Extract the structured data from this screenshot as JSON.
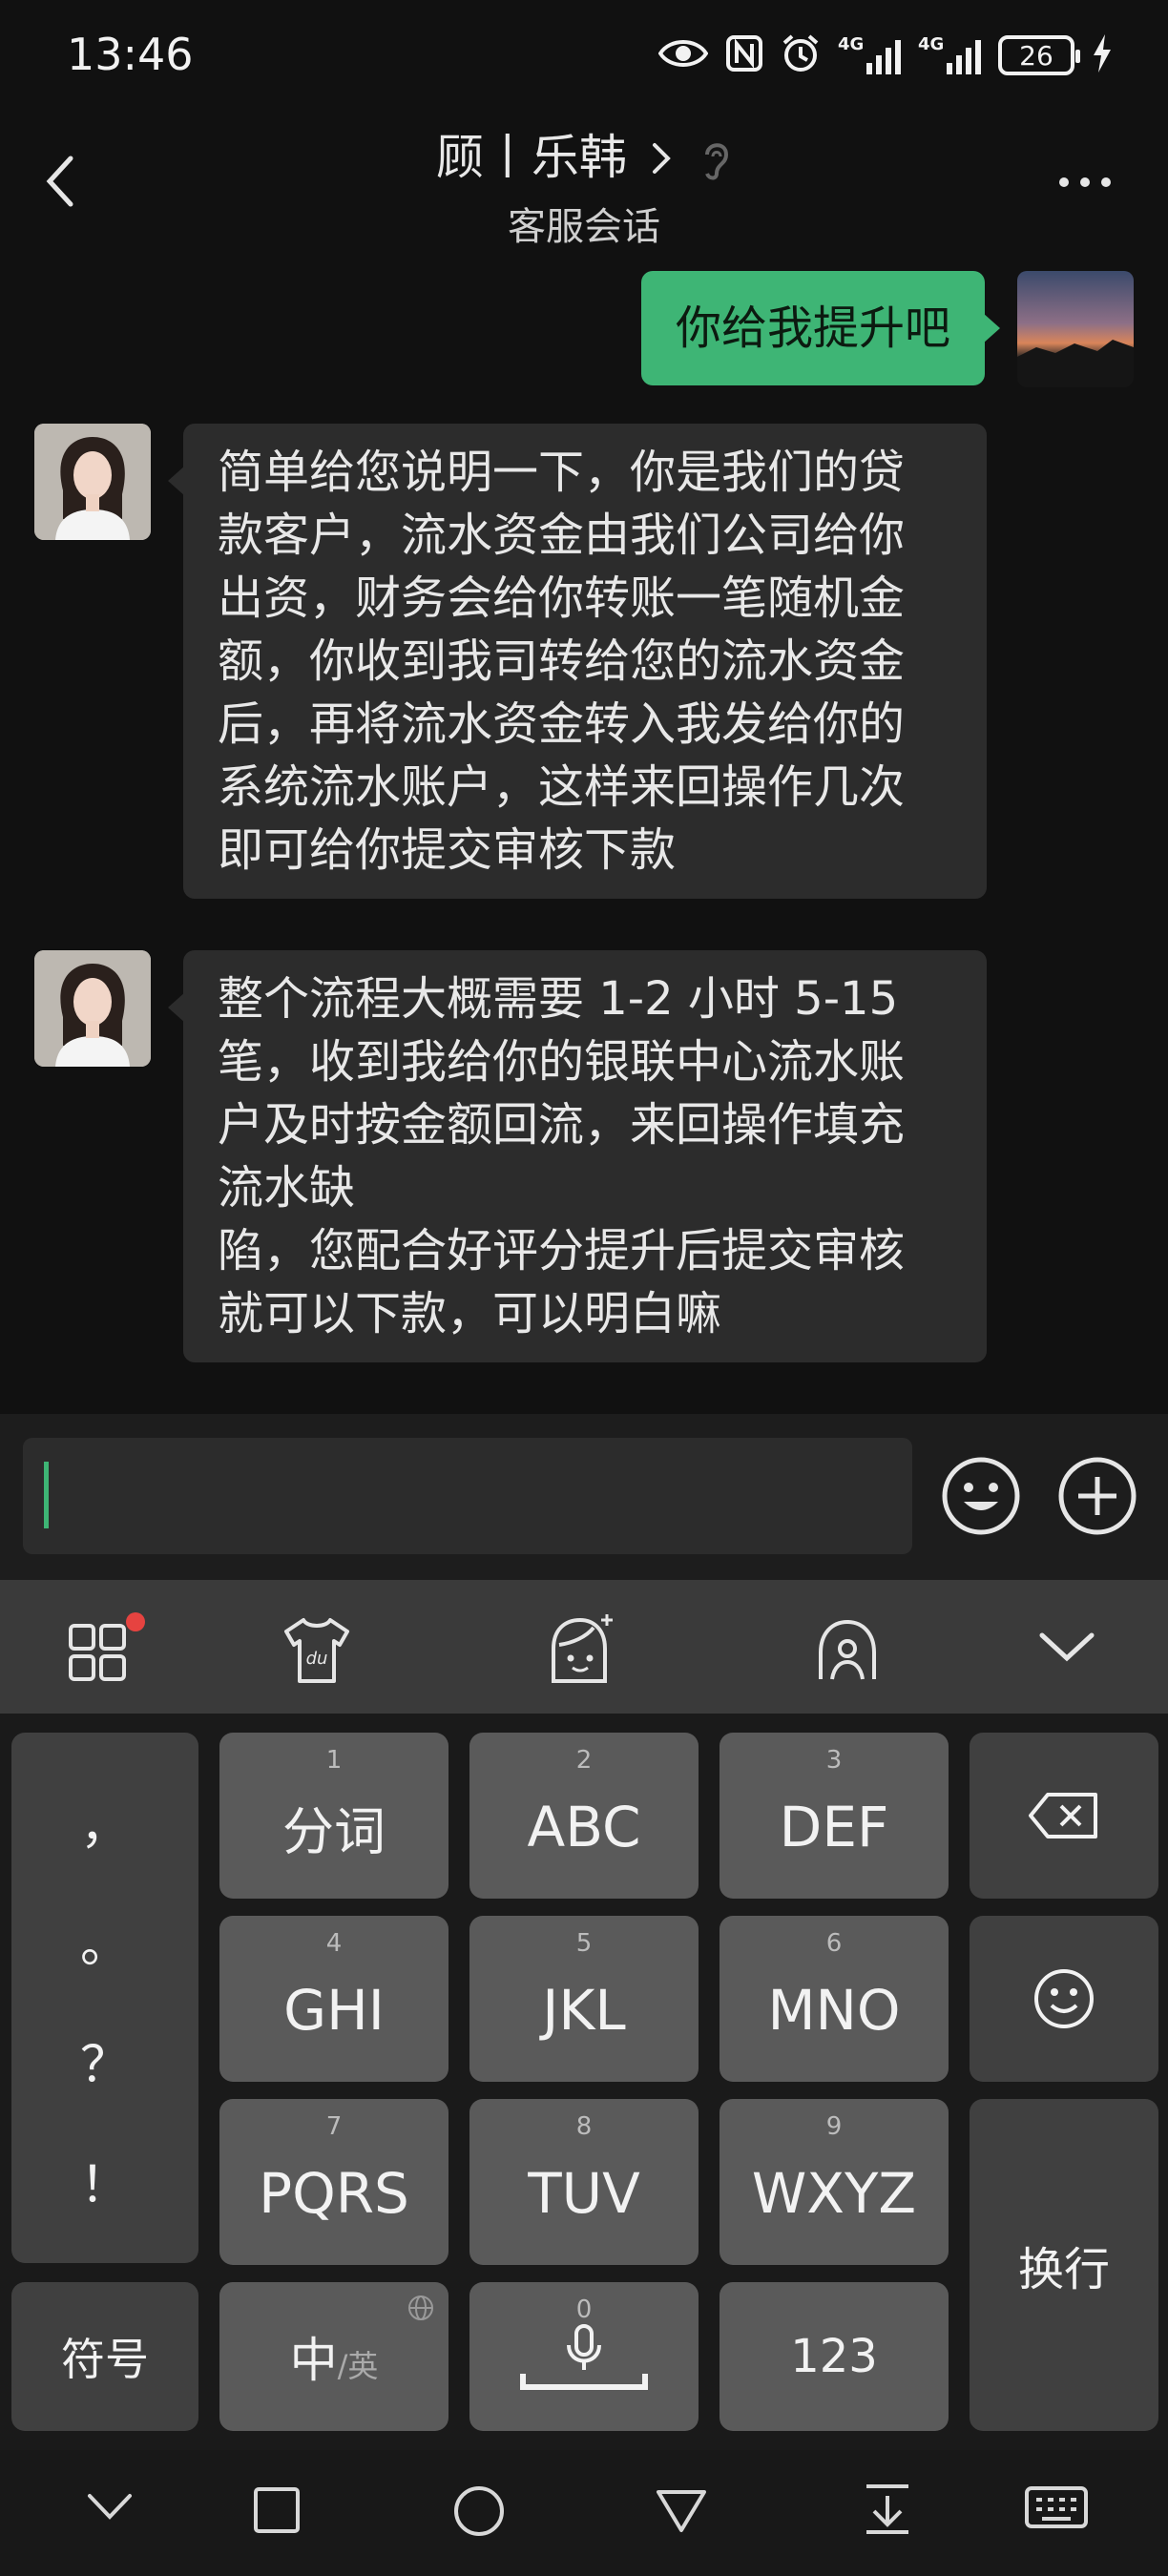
{
  "status_bar": {
    "time": "13:46",
    "network_1": "4G",
    "network_2": "4G",
    "battery": "26",
    "icons": [
      "eye-icon",
      "nfc-icon",
      "alarm-icon",
      "signal-icon",
      "battery-icon",
      "charging-icon"
    ]
  },
  "header": {
    "title": "顾丨乐韩",
    "subtitle": "客服会话"
  },
  "messages": [
    {
      "sender": "me",
      "text": "你给我提升吧"
    },
    {
      "sender": "agent",
      "lines": [
        "简单给您说明一下，你是我们的贷",
        "款客户，流水资金由我们公司给你",
        "出资，财务会给你转账一笔随机金",
        "额，你收到我司转给您的流水资金",
        "后，再将流水资金转入我发给你的",
        "系统流水账户，这样来回操作几次",
        "即可给你提交审核下款"
      ]
    },
    {
      "sender": "agent",
      "lines": [
        "整个流程大概需要 1-2 小时 5-15",
        "笔，收到我给你的银联中心流水账",
        "户及时按金额回流，来回操作填充",
        "流水缺",
        "陷，您配合好评分提升后提交审核",
        "就可以下款，可以明白嘛"
      ]
    }
  ],
  "keyboard": {
    "punctuation": [
      "，",
      "。",
      "？",
      "！"
    ],
    "keys": [
      {
        "num": "1",
        "label": "分词"
      },
      {
        "num": "2",
        "label": "ABC"
      },
      {
        "num": "3",
        "label": "DEF"
      },
      {
        "num": "4",
        "label": "GHI"
      },
      {
        "num": "5",
        "label": "JKL"
      },
      {
        "num": "6",
        "label": "MNO"
      },
      {
        "num": "7",
        "label": "PQRS"
      },
      {
        "num": "8",
        "label": "TUV"
      },
      {
        "num": "9",
        "label": "WXYZ"
      }
    ],
    "symbols": "符号",
    "lang_main": "中",
    "lang_alt": "/英",
    "space_num": "0",
    "numbers": "123",
    "enter": "换行"
  },
  "colors": {
    "accent_green": "#3eb575",
    "notification_red": "#e64340"
  }
}
